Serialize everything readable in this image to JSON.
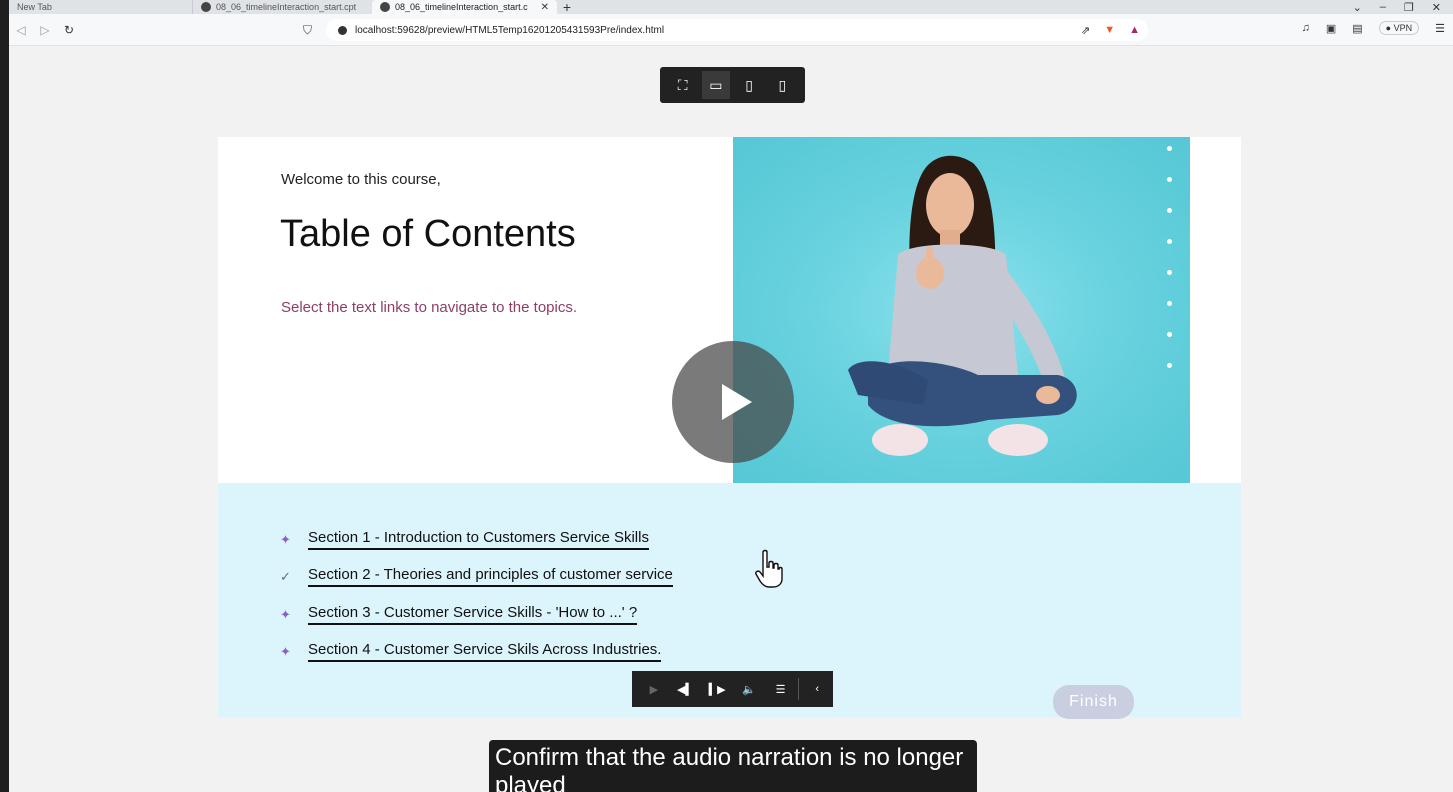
{
  "browser": {
    "tabs": [
      {
        "label": "New Tab"
      },
      {
        "label": "08_06_timelineInteraction_start.cpt"
      },
      {
        "label": "08_06_timelineInteraction_start.c"
      }
    ],
    "new_tab": "+",
    "url": "localhost:59628/preview/HTML5Temp16201205431593Pre/index.html",
    "vpn_label": "VPN"
  },
  "slide": {
    "welcome": "Welcome to this course,",
    "title": "Table of Contents",
    "subtitle": "Select the text links to navigate to the topics.",
    "sections": [
      {
        "label": "Section 1 - Introduction to Customers Service Skills",
        "marker": "✦",
        "visited": false
      },
      {
        "label": "Section 2 -  Theories and principles of customer service",
        "marker": "✓",
        "visited": true
      },
      {
        "label": "Section 3 - Customer Service Skills - 'How to ...' ?",
        "marker": "✦",
        "visited": false
      },
      {
        "label": "Section 4 - Customer Service Skils Across Industries.",
        "marker": "✦",
        "visited": false
      }
    ],
    "finish_label": "Finish"
  },
  "caption": {
    "text": "Confirm that the audio narration is no longer played"
  },
  "colors": {
    "accent_purple": "#8b5cc8",
    "subtitle_color": "#8e3e67",
    "photo_bg": "#6ad3df",
    "bottom_panel": "#dcf4fc"
  }
}
